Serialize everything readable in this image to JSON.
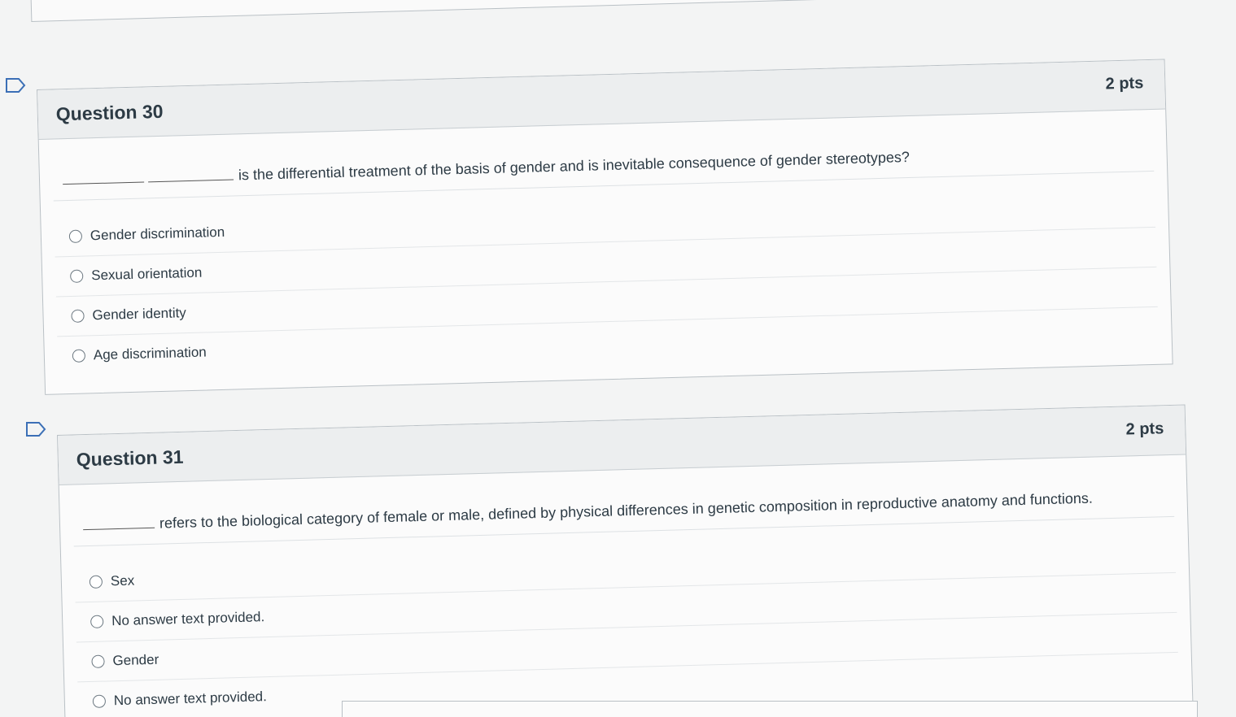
{
  "questions": [
    {
      "title": "Question 30",
      "points": "2 pts",
      "prompt": "is the differential treatment of the basis of gender and is inevitable consequence of gender stereotypes?",
      "answers": [
        "Gender discrimination",
        "Sexual orientation",
        "Gender identity",
        "Age discrimination"
      ]
    },
    {
      "title": "Question 31",
      "points": "2 pts",
      "prompt": "refers to the biological category of female or male, defined by physical differences in genetic composition in reproductive anatomy and functions.",
      "answers": [
        "Sex",
        "No answer text provided.",
        "Gender",
        "No answer text provided."
      ]
    }
  ],
  "icons": {
    "flag": "flag-question-icon",
    "radio": "radio-button"
  }
}
